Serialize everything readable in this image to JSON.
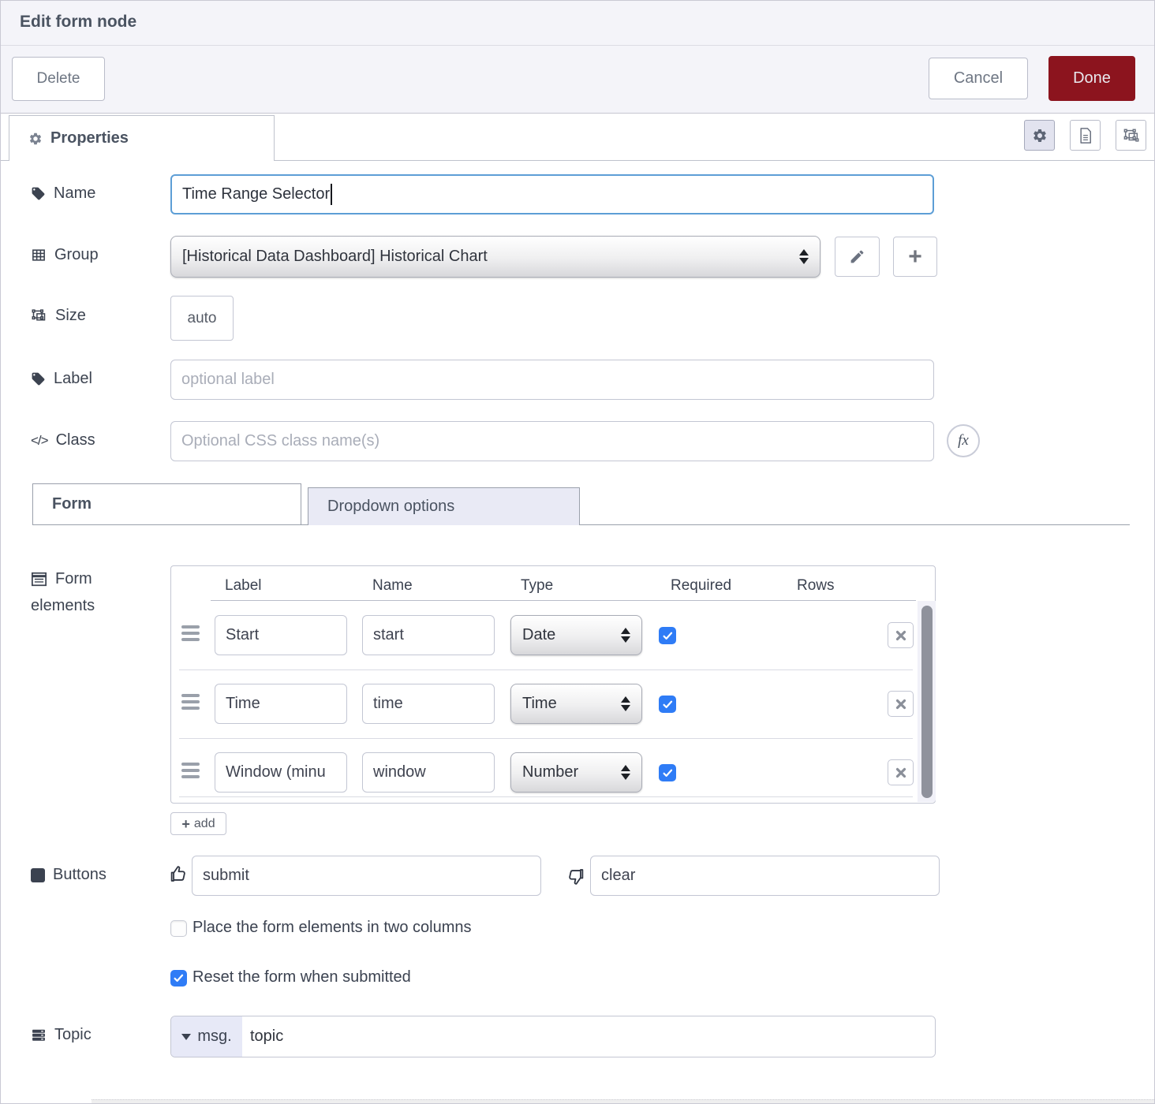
{
  "dialog": {
    "title": "Edit form node"
  },
  "toolbar": {
    "delete_label": "Delete",
    "cancel_label": "Cancel",
    "done_label": "Done"
  },
  "tabs": {
    "properties_label": "Properties"
  },
  "fields": {
    "name": {
      "label": "Name",
      "value": "Time Range Selector"
    },
    "group": {
      "label": "Group",
      "value": "[Historical Data Dashboard] Historical Chart"
    },
    "size": {
      "label": "Size",
      "value": "auto"
    },
    "label": {
      "label": "Label",
      "placeholder": "optional label"
    },
    "css_class": {
      "label": "Class",
      "placeholder": "Optional CSS class name(s)",
      "fx_label": "fx"
    }
  },
  "subtabs": {
    "form_label": "Form",
    "dropdown_label": "Dropdown options"
  },
  "form_elements": {
    "section_label_line1": "Form",
    "section_label_line2": "elements",
    "columns": [
      "Label",
      "Name",
      "Type",
      "Required",
      "Rows"
    ],
    "rows": [
      {
        "label": "Start",
        "name": "start",
        "type": "Date",
        "required": true
      },
      {
        "label": "Time",
        "name": "time",
        "type": "Time",
        "required": true
      },
      {
        "label": "Window (minu",
        "name": "window",
        "type": "Number",
        "required": true
      }
    ],
    "add_label": "add"
  },
  "buttons_section": {
    "label": "Buttons",
    "submit_value": "submit",
    "clear_value": "clear"
  },
  "options": {
    "two_columns": {
      "label": "Place the form elements in two columns",
      "checked": false
    },
    "reset_on_submit": {
      "label": "Reset the form when submitted",
      "checked": true
    }
  },
  "topic": {
    "label": "Topic",
    "prefix": "msg.",
    "value": "topic"
  },
  "colors": {
    "done_red": "#8c141e",
    "checkbox_blue": "#2f7cf6",
    "focus_blue": "#5d9ed6",
    "header_bg": "#f4f4f9"
  }
}
